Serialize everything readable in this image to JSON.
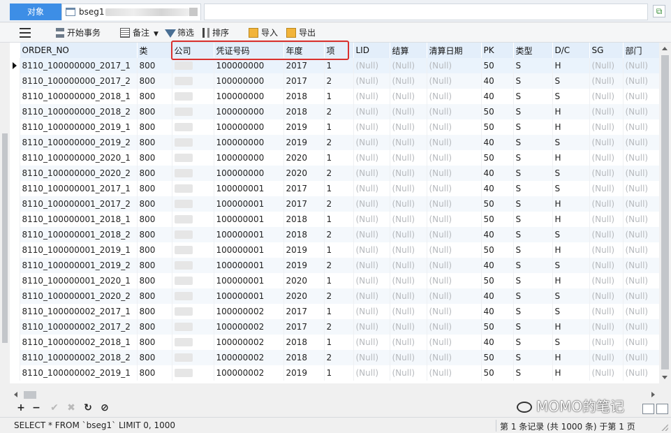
{
  "tabs": {
    "objects_label": "对象",
    "table_tab_label": "bseg1"
  },
  "toolbar": {
    "begin_transaction": "开始事务",
    "memo": "备注",
    "filter": "筛选",
    "sort": "排序",
    "import": "导入",
    "export": "导出"
  },
  "grid": {
    "columns": [
      "ORDER_NO",
      "类",
      "公司",
      "凭证号码",
      "年度",
      "项",
      "LID",
      "结算",
      "清算日期",
      "PK",
      "类型",
      "D/C",
      "SG",
      "部门"
    ],
    "null_text": "(Null)",
    "rows": [
      {
        "order_no": "8110_100000000_2017_1",
        "cls": "800",
        "doc_no": "100000000",
        "year": "2017",
        "item": "1",
        "pk": "50",
        "type": "S",
        "dc": "H"
      },
      {
        "order_no": "8110_100000000_2017_2",
        "cls": "800",
        "doc_no": "100000000",
        "year": "2017",
        "item": "2",
        "pk": "40",
        "type": "S",
        "dc": "S"
      },
      {
        "order_no": "8110_100000000_2018_1",
        "cls": "800",
        "doc_no": "100000000",
        "year": "2018",
        "item": "1",
        "pk": "40",
        "type": "S",
        "dc": "S"
      },
      {
        "order_no": "8110_100000000_2018_2",
        "cls": "800",
        "doc_no": "100000000",
        "year": "2018",
        "item": "2",
        "pk": "50",
        "type": "S",
        "dc": "H"
      },
      {
        "order_no": "8110_100000000_2019_1",
        "cls": "800",
        "doc_no": "100000000",
        "year": "2019",
        "item": "1",
        "pk": "50",
        "type": "S",
        "dc": "H"
      },
      {
        "order_no": "8110_100000000_2019_2",
        "cls": "800",
        "doc_no": "100000000",
        "year": "2019",
        "item": "2",
        "pk": "40",
        "type": "S",
        "dc": "S"
      },
      {
        "order_no": "8110_100000000_2020_1",
        "cls": "800",
        "doc_no": "100000000",
        "year": "2020",
        "item": "1",
        "pk": "50",
        "type": "S",
        "dc": "H"
      },
      {
        "order_no": "8110_100000000_2020_2",
        "cls": "800",
        "doc_no": "100000000",
        "year": "2020",
        "item": "2",
        "pk": "40",
        "type": "S",
        "dc": "S"
      },
      {
        "order_no": "8110_100000001_2017_1",
        "cls": "800",
        "doc_no": "100000001",
        "year": "2017",
        "item": "1",
        "pk": "40",
        "type": "S",
        "dc": "S"
      },
      {
        "order_no": "8110_100000001_2017_2",
        "cls": "800",
        "doc_no": "100000001",
        "year": "2017",
        "item": "2",
        "pk": "50",
        "type": "S",
        "dc": "H"
      },
      {
        "order_no": "8110_100000001_2018_1",
        "cls": "800",
        "doc_no": "100000001",
        "year": "2018",
        "item": "1",
        "pk": "50",
        "type": "S",
        "dc": "H"
      },
      {
        "order_no": "8110_100000001_2018_2",
        "cls": "800",
        "doc_no": "100000001",
        "year": "2018",
        "item": "2",
        "pk": "40",
        "type": "S",
        "dc": "S"
      },
      {
        "order_no": "8110_100000001_2019_1",
        "cls": "800",
        "doc_no": "100000001",
        "year": "2019",
        "item": "1",
        "pk": "50",
        "type": "S",
        "dc": "H"
      },
      {
        "order_no": "8110_100000001_2019_2",
        "cls": "800",
        "doc_no": "100000001",
        "year": "2019",
        "item": "2",
        "pk": "40",
        "type": "S",
        "dc": "S"
      },
      {
        "order_no": "8110_100000001_2020_1",
        "cls": "800",
        "doc_no": "100000001",
        "year": "2020",
        "item": "1",
        "pk": "50",
        "type": "S",
        "dc": "H"
      },
      {
        "order_no": "8110_100000001_2020_2",
        "cls": "800",
        "doc_no": "100000001",
        "year": "2020",
        "item": "2",
        "pk": "40",
        "type": "S",
        "dc": "S"
      },
      {
        "order_no": "8110_100000002_2017_1",
        "cls": "800",
        "doc_no": "100000002",
        "year": "2017",
        "item": "1",
        "pk": "40",
        "type": "S",
        "dc": "S"
      },
      {
        "order_no": "8110_100000002_2017_2",
        "cls": "800",
        "doc_no": "100000002",
        "year": "2017",
        "item": "2",
        "pk": "50",
        "type": "S",
        "dc": "H"
      },
      {
        "order_no": "8110_100000002_2018_1",
        "cls": "800",
        "doc_no": "100000002",
        "year": "2018",
        "item": "1",
        "pk": "40",
        "type": "S",
        "dc": "S"
      },
      {
        "order_no": "8110_100000002_2018_2",
        "cls": "800",
        "doc_no": "100000002",
        "year": "2018",
        "item": "2",
        "pk": "50",
        "type": "S",
        "dc": "H"
      },
      {
        "order_no": "8110_100000002_2019_1",
        "cls": "800",
        "doc_no": "100000002",
        "year": "2019",
        "item": "1",
        "pk": "50",
        "type": "S",
        "dc": "H"
      }
    ]
  },
  "navbar": {
    "add": "+",
    "delete": "−",
    "apply": "✔",
    "discard": "✖",
    "refresh": "↻",
    "stop": "⊘"
  },
  "watermark": "MOMO的笔记",
  "status": {
    "sql": "SELECT * FROM `bseg1` LIMIT 0, 1000",
    "page_info": "第 1 条记录 (共 1000 条) 于第 1 页"
  },
  "colors": {
    "accent": "#3d8ee6",
    "header_bg": "#e3eefa",
    "highlight_box": "#d9302e",
    "null_text": "#b6b9bd"
  }
}
